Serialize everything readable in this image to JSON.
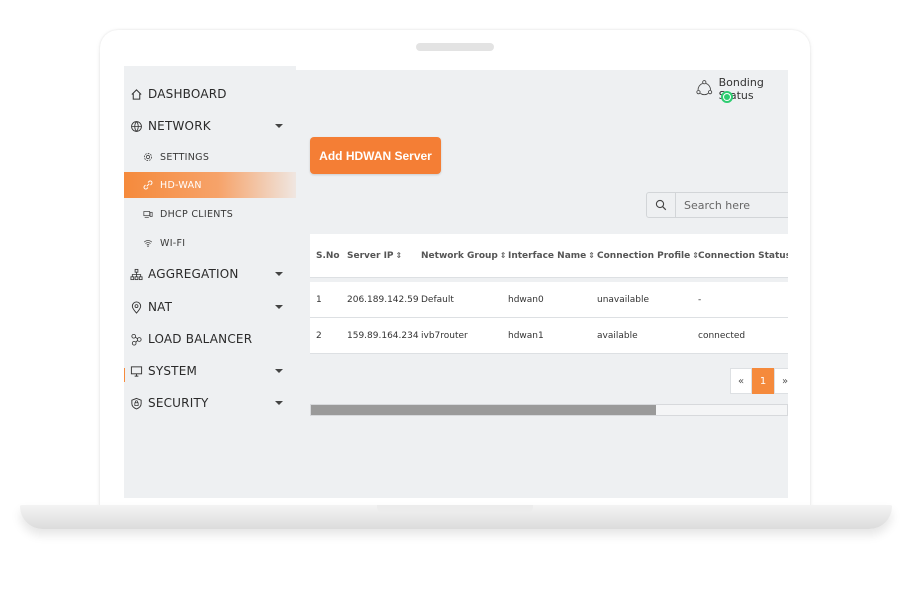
{
  "sidebar": {
    "items": [
      {
        "label": "DASHBOARD",
        "icon": "home-icon"
      },
      {
        "label": "NETWORK",
        "icon": "globe-icon"
      },
      {
        "label": "AGGREGATION",
        "icon": "hierarchy-icon"
      },
      {
        "label": "NAT",
        "icon": "location-pin-icon"
      },
      {
        "label": "LOAD BALANCER",
        "icon": "nodes-icon"
      },
      {
        "label": "SYSTEM",
        "icon": "monitor-icon"
      },
      {
        "label": "SECURITY",
        "icon": "shield-icon"
      }
    ],
    "network_sub": [
      {
        "label": "SETTINGS",
        "icon": "gear-icon"
      },
      {
        "label": "HD-WAN",
        "icon": "link-icon",
        "active": true
      },
      {
        "label": "DHCP CLIENTS",
        "icon": "devices-icon"
      },
      {
        "label": "WI-FI",
        "icon": "wifi-icon"
      }
    ]
  },
  "header": {
    "bonding_label": "Bonding Status",
    "bonding_status_color": "#2ecc71"
  },
  "main": {
    "add_button_label": "Add HDWAN Server",
    "search_placeholder": "Search here",
    "table": {
      "columns": [
        "S.No",
        "Server IP",
        "Network Group",
        "Interface Name",
        "Connection Profile",
        "Connection Status"
      ],
      "rows": [
        [
          "1",
          "206.189.142.59",
          "Default",
          "hdwan0",
          "unavailable",
          "-"
        ],
        [
          "2",
          "159.89.164.234",
          "ivb7router",
          "hdwan1",
          "available",
          "connected"
        ]
      ]
    },
    "pagination": {
      "prev": "«",
      "current": "1",
      "next": "»"
    }
  },
  "colors": {
    "accent": "#f47e35",
    "background": "#eef0f2"
  }
}
